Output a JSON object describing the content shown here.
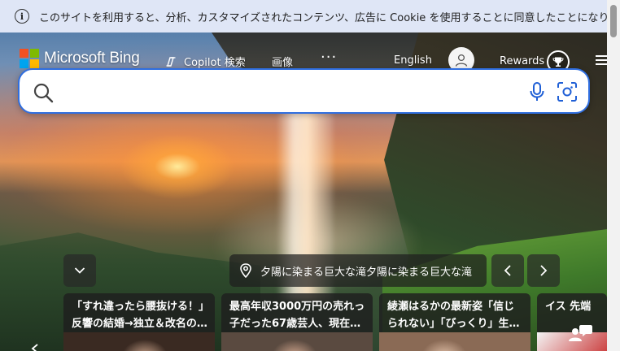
{
  "cookie": {
    "text": "このサイトを利用すると、分析、カスタマイズされたコンテンツ、広告に Cookie を使用することに同意したことになります。",
    "close_symbol": "×"
  },
  "header": {
    "brand": "Microsoft Bing",
    "nav": [
      {
        "label": "Copilot 検索",
        "icon": "copilot-icon"
      },
      {
        "label": "画像"
      }
    ],
    "more": "···",
    "language": "English",
    "rewards": "Rewards",
    "menu_icon": "hamburger-icon"
  },
  "search": {
    "value": "",
    "placeholder": "",
    "icons": [
      "search-icon",
      "microphone-icon",
      "visual-search-icon"
    ]
  },
  "background": {
    "caption": "夕陽に染まる巨大な滝夕陽に染まる巨大な滝"
  },
  "news": [
    {
      "title": "「すれ違ったら腰抜ける！」反響の結婚→独立＆改名の…"
    },
    {
      "title": "最高年収3000万円の売れっ子だった67歳芸人、現在…"
    },
    {
      "title": "綾瀬はるかの最新姿「信じられない」「びっくり」生…"
    },
    {
      "title": "イス 先端"
    }
  ],
  "colors": {
    "cookie_bg": "#dfe6f6",
    "search_border": "#2f6ee0",
    "icon_blue": "#1f5fd6"
  }
}
